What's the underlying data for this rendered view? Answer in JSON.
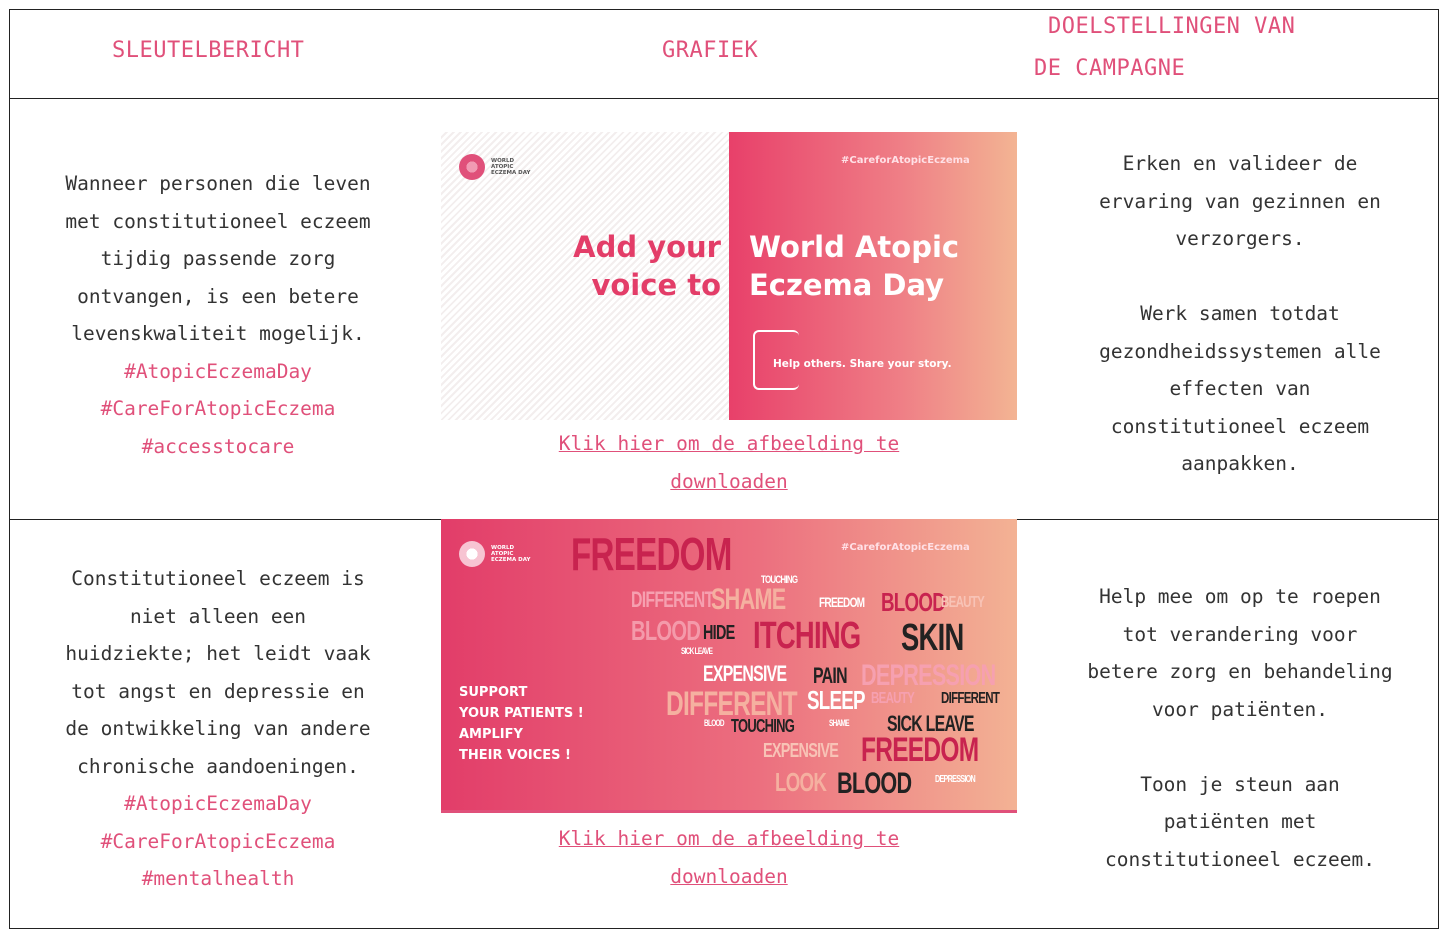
{
  "headers": {
    "key_message": "SLEUTELBERICHT",
    "graphic": "GRAFIEK",
    "goals_line1": "DOELSTELLINGEN VAN",
    "goals_line2": "DE CAMPAGNE"
  },
  "rows": [
    {
      "message_lines": [
        "Wanneer personen die leven",
        "met constitutioneel eczeem",
        "tijdig passende zorg",
        "ontvangen, is een betere",
        "levenskwaliteit mogelijk."
      ],
      "hashtags": [
        "#AtopicEczemaDay",
        "#CareForAtopicEczema",
        "#accesstocare"
      ],
      "graphic": {
        "logo_text": "WORLD ATOPIC ECZEMA DAY",
        "hashtag": "#CareforAtopicEczema",
        "left_text_1": "Add your",
        "left_text_2": "voice to",
        "right_text_1": "World Atopic",
        "right_text_2": "Eczema Day",
        "bubble_text": "Help others. Share your story."
      },
      "link_line1": "Klik hier om de afbeelding te",
      "link_line2": "downloaden",
      "goals": [
        [
          "Erken en valideer de",
          "ervaring van gezinnen en",
          "verzorgers."
        ],
        [
          "Werk samen totdat",
          "gezondheidssystemen alle",
          "effecten van",
          "constitutioneel eczeem",
          "aanpakken."
        ]
      ]
    },
    {
      "message_lines": [
        "Constitutioneel eczeem is",
        "niet alleen een",
        "huidziekte; het leidt vaak",
        "tot angst en depressie en",
        "de ontwikkeling van andere",
        "chronische aandoeningen."
      ],
      "hashtags": [
        "#AtopicEczemaDay",
        "#CareForAtopicEczema",
        "#mentalhealth"
      ],
      "graphic": {
        "logo_text": "WORLD ATOPIC ECZEMA DAY",
        "hashtag": "#CareforAtopicEczema",
        "support_lines": [
          "SUPPORT",
          "YOUR PATIENTS !",
          "AMPLIFY",
          "THEIR VOICES !"
        ],
        "words": [
          "FREEDOM",
          "TOUCHING",
          "DIFFERENT",
          "SHAME",
          "FREEDOM",
          "BLOOD",
          "BEAUTY",
          "BLOOD",
          "HIDE",
          "ITCHING",
          "SKIN",
          "SICK LEAVE",
          "EXPENSIVE",
          "PAIN",
          "DEPRESSION",
          "DIFFERENT",
          "SLEEP",
          "BEAUTY",
          "DIFFERENT",
          "BLOOD",
          "TOUCHING",
          "SHAME",
          "SICK LEAVE",
          "EXPENSIVE",
          "FREEDOM",
          "LOOK",
          "BLOOD",
          "DEPRESSION"
        ]
      },
      "link_line1": "Klik hier om de afbeelding te",
      "link_line2": "downloaden",
      "goals": [
        [
          "Help mee om op te roepen",
          "tot verandering voor",
          "betere zorg en behandeling",
          "voor patiënten."
        ],
        [
          "Toon je steun aan",
          "patiënten met",
          "constitutioneel eczeem."
        ]
      ]
    }
  ]
}
